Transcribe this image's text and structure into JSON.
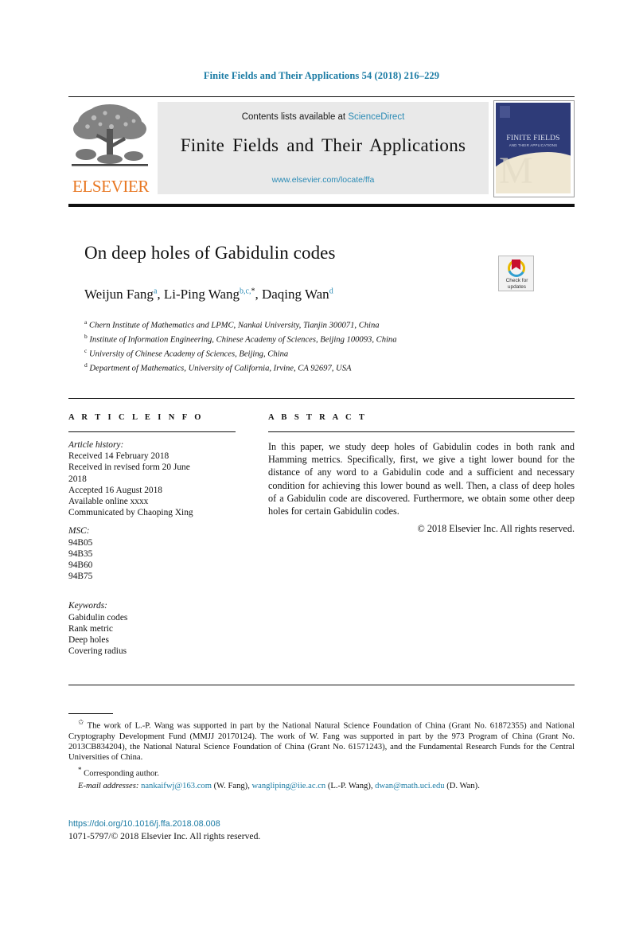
{
  "running_head": "Finite Fields and Their Applications 54 (2018) 216–229",
  "masthead": {
    "contents_prefix": "Contents lists available at",
    "sciencedirect": "ScienceDirect",
    "journal_name": "Finite Fields and Their Applications",
    "journal_url": "www.elsevier.com/locate/ffa",
    "publisher": "ELSEVIER",
    "publisher_logo_icon": "elsevier-tree-icon",
    "cover": {
      "title": "FINITE FIELDS",
      "subtitle": "AND THEIR APPLICATIONS",
      "watermark": "M"
    }
  },
  "article": {
    "title": "On deep holes of Gabidulin codes",
    "authors": [
      {
        "name": "Weijun Fang",
        "marks": "a"
      },
      {
        "name": "Li-Ping Wang",
        "marks": "b,c,",
        "star": "*"
      },
      {
        "name": "Daqing Wan",
        "marks": "d"
      }
    ],
    "authors_separator": ", ",
    "affiliations": [
      {
        "mark": "a",
        "text": "Chern Institute of Mathematics and LPMC, Nankai University, Tianjin 300071, China"
      },
      {
        "mark": "b",
        "text": "Institute of Information Engineering, Chinese Academy of Sciences, Beijing 100093, China"
      },
      {
        "mark": "c",
        "text": "University of Chinese Academy of Sciences, Beijing, China"
      },
      {
        "mark": "d",
        "text": "Department of Mathematics, University of California, Irvine, CA 92697, USA"
      }
    ],
    "crossmark": {
      "label_line1": "Check for",
      "label_line2": "updates",
      "icon": "crossmark-check-for-updates-icon"
    }
  },
  "article_info": {
    "heading": "A R T I C L E   I N F O",
    "history_label": "Article history:",
    "history": [
      "Received 14 February 2018",
      "Received in revised form 20 June",
      "2018",
      "Accepted 16 August 2018",
      "Available online xxxx",
      "Communicated by Chaoping Xing"
    ],
    "msc_label": "MSC:",
    "msc": [
      "94B05",
      "94B35",
      "94B60",
      "94B75"
    ],
    "keywords_label": "Keywords:",
    "keywords": [
      "Gabidulin codes",
      "Rank metric",
      "Deep holes",
      "Covering radius"
    ]
  },
  "abstract": {
    "heading": "A B S T R A C T",
    "body": "In this paper, we study deep holes of Gabidulin codes in both rank and Hamming metrics. Specifically, first, we give a tight lower bound for the distance of any word to a Gabidulin code and a sufficient and necessary condition for achieving this lower bound as well. Then, a class of deep holes of a Gabidulin code are discovered. Furthermore, we obtain some other deep holes for certain Gabidulin codes.",
    "copyright": "© 2018 Elsevier Inc. All rights reserved."
  },
  "footnotes": {
    "funding_star": "✩",
    "funding": "The work of L.-P. Wang was supported in part by the National Natural Science Foundation of China (Grant No. 61872355) and National Cryptography Development Fund (MMJJ 20170124). The work of W. Fang was supported in part by the 973 Program of China (Grant No. 2013CB834204), the National Natural Science Foundation of China (Grant No. 61571243), and the Fundamental Research Funds for the Central Universities of China.",
    "corresponding_star": "*",
    "corresponding": "Corresponding author.",
    "email_label": "E-mail addresses:",
    "emails": [
      {
        "address": "nankaifwj@163.com",
        "owner": "(W. Fang),"
      },
      {
        "address": "wangliping@iie.ac.cn",
        "owner": "(L.-P. Wang),"
      },
      {
        "address": "dwan@math.uci.edu",
        "owner": "(D. Wan)."
      }
    ]
  },
  "publication": {
    "doi": "https://doi.org/10.1016/j.ffa.2018.08.008",
    "issn_line": "1071-5797/© 2018 Elsevier Inc. All rights reserved."
  },
  "colors": {
    "link": "#1a7ba4",
    "sciencedirect": "#2b8bb5",
    "elsevier_orange": "#e87722",
    "cover_blue": "#2e3b78"
  }
}
